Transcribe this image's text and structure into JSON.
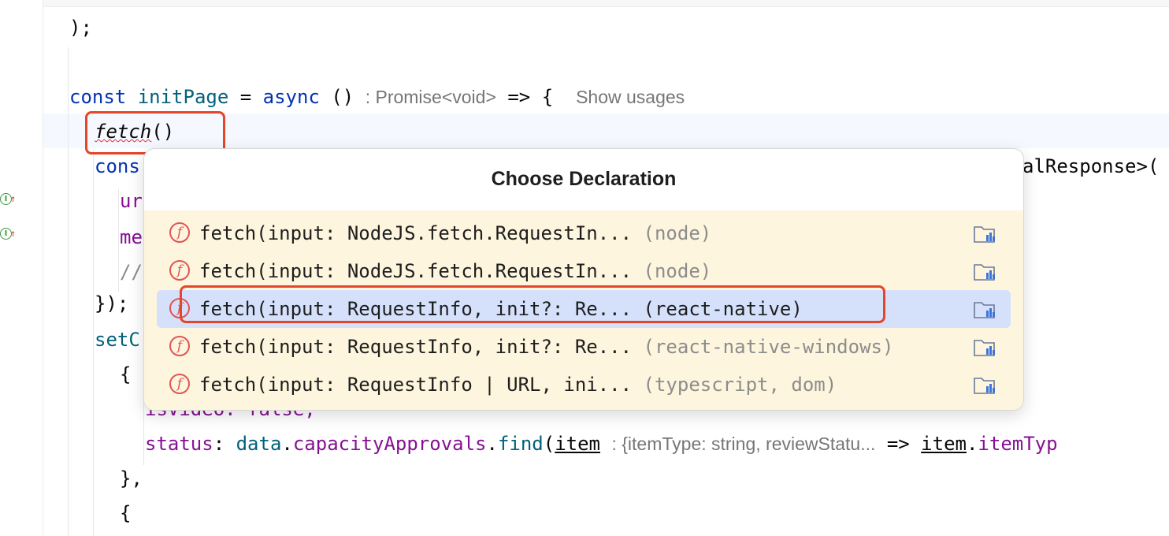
{
  "editor": {
    "lines": {
      "close_paren": ");",
      "const_kw": "const",
      "init_page": "initPage",
      "eq": " = ",
      "async_kw": "async",
      "parens": " () ",
      "return_hint": ": Promise<void>",
      "arrow_brace": " => {",
      "show_usages": "Show usages",
      "fetch_call": "fetch",
      "fetch_parens": "()",
      "cons": "cons",
      "al_response": "alResponse>(",
      "ur": "ur",
      "me": "me",
      "comment_slash": "//",
      "close_obj": "});",
      "set_c": "setC",
      "open_brace_1": "{",
      "is_video": "isVideo: false,",
      "status_key": "status",
      "colon": ": ",
      "data_obj": "data",
      "dot": ".",
      "capacity": "capacityApprovals",
      "find": "find",
      "open_paren": "(",
      "item": "item",
      "item_hint": ": {itemType: string, reviewStatu...",
      "arrow": " => ",
      "item_type": "itemTyp",
      "close_brace_comma": "},",
      "open_brace_2": "{"
    }
  },
  "popup": {
    "title": "Choose Declaration",
    "items": [
      {
        "sig": "fetch(input: NodeJS.fetch.RequestIn...",
        "lib": "(node)",
        "icon": "function-icon"
      },
      {
        "sig": "fetch(input: NodeJS.fetch.RequestIn...",
        "lib": "(node)",
        "icon": "function-icon"
      },
      {
        "sig": "fetch(input: RequestInfo, init?: Re...",
        "lib": "(react-native)",
        "icon": "function-icon",
        "selected": true
      },
      {
        "sig": "fetch(input: RequestInfo, init?: Re...",
        "lib": "(react-native-windows)",
        "icon": "function-icon"
      },
      {
        "sig": "fetch(input: RequestInfo | URL, ini...",
        "lib": "(typescript, dom)",
        "icon": "function-icon"
      }
    ]
  },
  "gutter": {
    "icon_1": "I",
    "icon_2": "I",
    "arrow": "↑"
  },
  "colors": {
    "keyword": "#0033b3",
    "function": "#00627a",
    "property": "#871094",
    "highlight_box": "#e3462a",
    "popup_list_bg": "#fdf5dd",
    "selected_row": "#d5e1fb"
  }
}
